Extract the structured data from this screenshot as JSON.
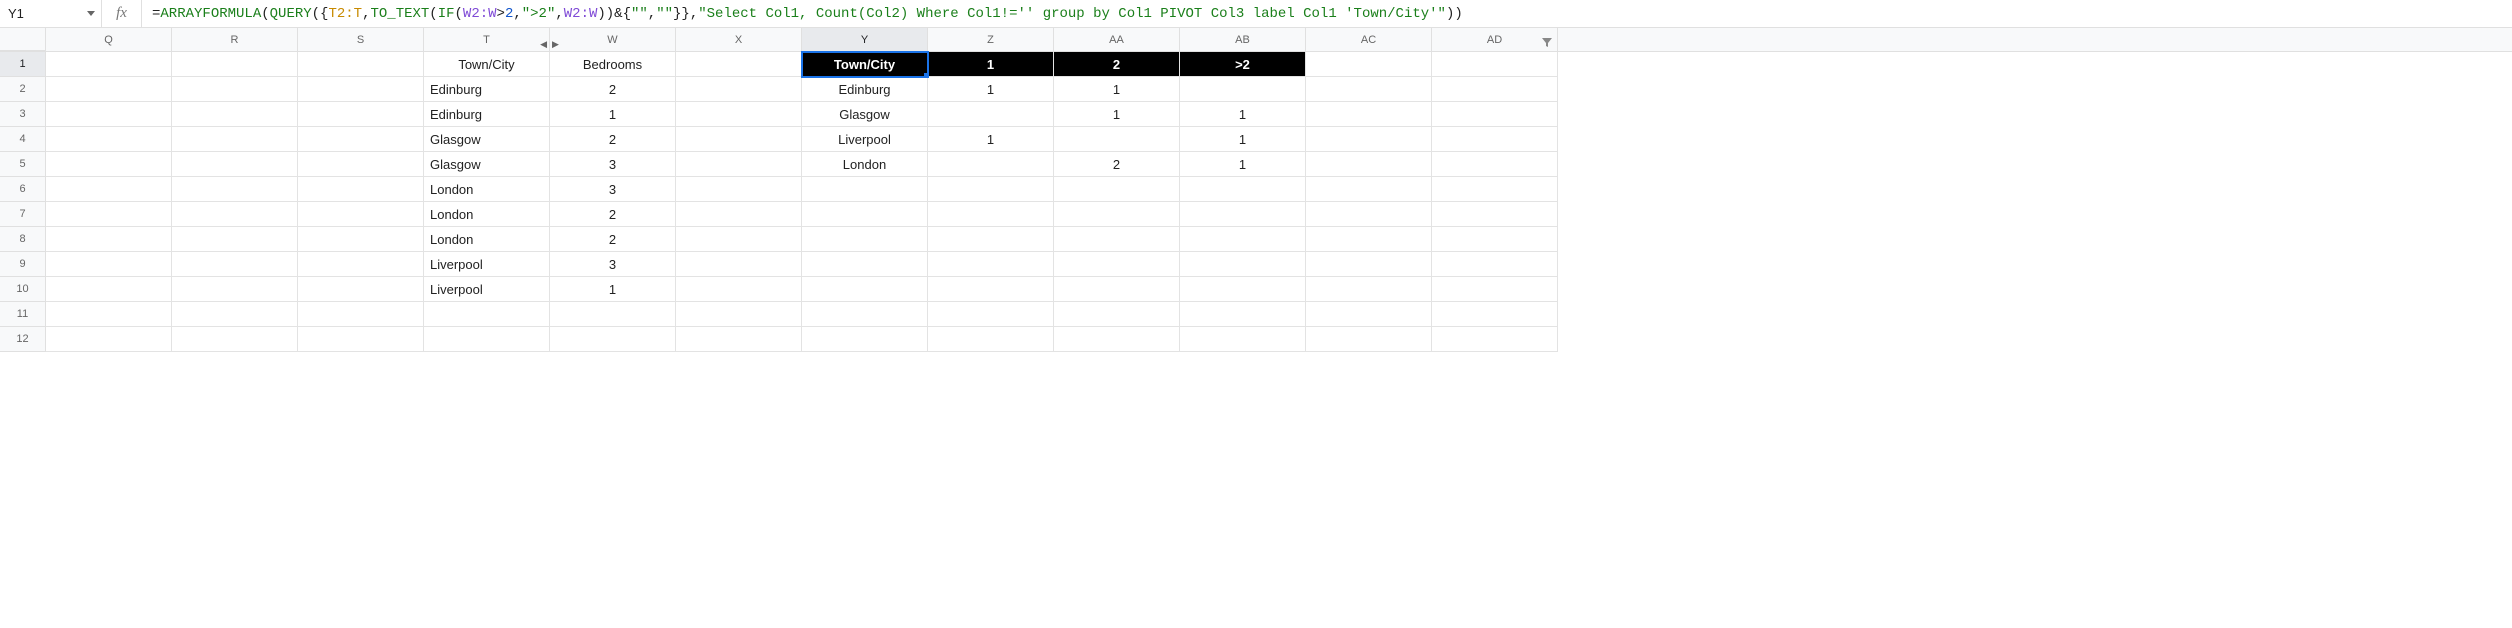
{
  "namebox": {
    "value": "Y1"
  },
  "formula": {
    "parts": [
      {
        "cls": "plain",
        "t": "="
      },
      {
        "cls": "fnname",
        "t": "ARRAYFORMULA"
      },
      {
        "cls": "plain",
        "t": "("
      },
      {
        "cls": "fnname",
        "t": "QUERY"
      },
      {
        "cls": "plain",
        "t": "({"
      },
      {
        "cls": "range1",
        "t": "T2:T"
      },
      {
        "cls": "plain",
        "t": ","
      },
      {
        "cls": "fnname",
        "t": "TO_TEXT"
      },
      {
        "cls": "plain",
        "t": "("
      },
      {
        "cls": "fnname",
        "t": "IF"
      },
      {
        "cls": "plain",
        "t": "("
      },
      {
        "cls": "range2",
        "t": "W2:W"
      },
      {
        "cls": "plain",
        "t": ">"
      },
      {
        "cls": "num",
        "t": "2"
      },
      {
        "cls": "plain",
        "t": ","
      },
      {
        "cls": "str",
        "t": "\">2\""
      },
      {
        "cls": "plain",
        "t": ","
      },
      {
        "cls": "range2",
        "t": "W2:W"
      },
      {
        "cls": "plain",
        "t": "))&{"
      },
      {
        "cls": "str",
        "t": "\"\""
      },
      {
        "cls": "plain",
        "t": ","
      },
      {
        "cls": "str",
        "t": "\"\""
      },
      {
        "cls": "plain",
        "t": "}},"
      },
      {
        "cls": "str",
        "t": "\"Select Col1, Count(Col2) Where Col1!='' group by Col1 PIVOT Col3 label Col1 'Town/City'\""
      },
      {
        "cls": "plain",
        "t": "))"
      }
    ]
  },
  "columns": [
    "Q",
    "R",
    "S",
    "T",
    "W",
    "X",
    "Y",
    "Z",
    "AA",
    "AB",
    "AC",
    "AD"
  ],
  "rows": [
    "1",
    "2",
    "3",
    "4",
    "5",
    "6",
    "7",
    "8",
    "9",
    "10",
    "11",
    "12"
  ],
  "active_col": "Y",
  "active_row": "1",
  "grid": {
    "1": {
      "T": {
        "v": "Town/City",
        "align": "center"
      },
      "W": {
        "v": "Bedrooms",
        "align": "center"
      },
      "Y": {
        "v": "Town/City",
        "hdr": true,
        "active": true
      },
      "Z": {
        "v": "1",
        "hdr": true
      },
      "AA": {
        "v": "2",
        "hdr": true
      },
      "AB": {
        "v": ">2",
        "hdr": true
      }
    },
    "2": {
      "T": {
        "v": "Edinburg"
      },
      "W": {
        "v": "2",
        "align": "center"
      },
      "Y": {
        "v": "Edinburg",
        "align": "center"
      },
      "Z": {
        "v": "1",
        "align": "center"
      },
      "AA": {
        "v": "1",
        "align": "center"
      }
    },
    "3": {
      "T": {
        "v": "Edinburg"
      },
      "W": {
        "v": "1",
        "align": "center"
      },
      "Y": {
        "v": "Glasgow",
        "align": "center"
      },
      "AA": {
        "v": "1",
        "align": "center"
      },
      "AB": {
        "v": "1",
        "align": "center"
      }
    },
    "4": {
      "T": {
        "v": "Glasgow"
      },
      "W": {
        "v": "2",
        "align": "center"
      },
      "Y": {
        "v": "Liverpool",
        "align": "center"
      },
      "Z": {
        "v": "1",
        "align": "center"
      },
      "AB": {
        "v": "1",
        "align": "center"
      }
    },
    "5": {
      "T": {
        "v": "Glasgow"
      },
      "W": {
        "v": "3",
        "align": "center"
      },
      "Y": {
        "v": "London",
        "align": "center"
      },
      "AA": {
        "v": "2",
        "align": "center"
      },
      "AB": {
        "v": "1",
        "align": "center"
      }
    },
    "6": {
      "T": {
        "v": "London"
      },
      "W": {
        "v": "3",
        "align": "center"
      }
    },
    "7": {
      "T": {
        "v": "London"
      },
      "W": {
        "v": "2",
        "align": "center"
      }
    },
    "8": {
      "T": {
        "v": "London"
      },
      "W": {
        "v": "2",
        "align": "center"
      }
    },
    "9": {
      "T": {
        "v": "Liverpool"
      },
      "W": {
        "v": "3",
        "align": "center"
      }
    },
    "10": {
      "T": {
        "v": "Liverpool"
      },
      "W": {
        "v": "1",
        "align": "center"
      }
    }
  },
  "chart_data": {
    "type": "table",
    "source_table": {
      "columns": [
        "Town/City",
        "Bedrooms"
      ],
      "rows": [
        [
          "Edinburg",
          2
        ],
        [
          "Edinburg",
          1
        ],
        [
          "Glasgow",
          2
        ],
        [
          "Glasgow",
          3
        ],
        [
          "London",
          3
        ],
        [
          "London",
          2
        ],
        [
          "London",
          2
        ],
        [
          "Liverpool",
          3
        ],
        [
          "Liverpool",
          1
        ]
      ]
    },
    "pivot_table": {
      "row_header": "Town/City",
      "columns": [
        "1",
        "2",
        ">2"
      ],
      "rows": [
        {
          "Town/City": "Edinburg",
          "1": 1,
          "2": 1,
          ">2": null
        },
        {
          "Town/City": "Glasgow",
          "1": null,
          "2": 1,
          ">2": 1
        },
        {
          "Town/City": "Liverpool",
          "1": 1,
          "2": null,
          ">2": 1
        },
        {
          "Town/City": "London",
          "1": null,
          "2": 2,
          ">2": 1
        }
      ]
    }
  }
}
